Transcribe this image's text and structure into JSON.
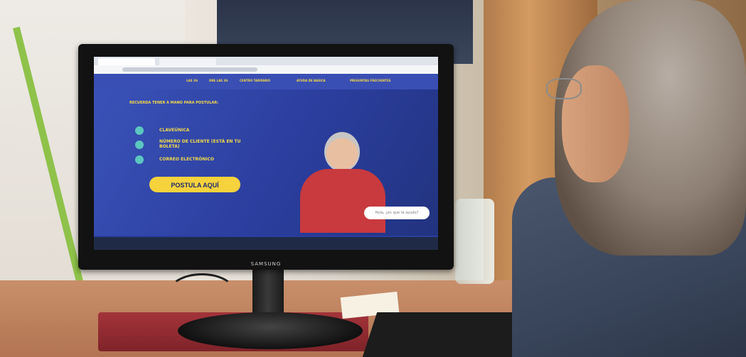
{
  "photo": {
    "subject": "",
    "monitor_brand": "SAMSUNG"
  },
  "website": {
    "nav_items": [
      "LAS 3G",
      "DRE LAS 3G",
      "CENTRO TARIFARIO",
      "AYUDA DE BASICA",
      "PREGUNTAS FRECUENTES"
    ],
    "headline": "RECUERDA TENER A MANO PARA POSTULAR:",
    "requirements": [
      {
        "text": "CLAVEÚNICA"
      },
      {
        "text": "NÚMERO DE CLIENTE (ESTÁ EN TU BOLETA)"
      },
      {
        "text": "CORREO ELECTRÓNICO"
      }
    ],
    "cta_label": "POSTULA AQUÍ",
    "chat_placeholder": "Hola, ¿en qué te ayudo?"
  },
  "colors": {
    "site_blue": "#2b3e9e",
    "site_yellow": "#f6d23d",
    "bullet_teal": "#5cc6c0"
  }
}
